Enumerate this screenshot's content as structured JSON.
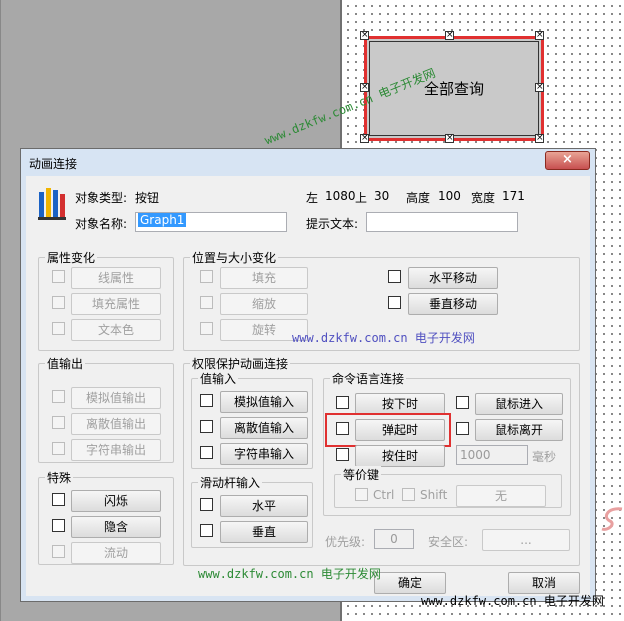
{
  "canvas": {
    "graph_button_label": "全部查询"
  },
  "dialog": {
    "title": "动画连接",
    "close_label": "×",
    "object_type_label": "对象类型:",
    "object_type_value": "按钮",
    "left_label": "左",
    "left_value": "1080",
    "top_label": "上",
    "top_value": "30",
    "height_label": "高度",
    "height_value": "100",
    "width_label": "宽度",
    "width_value": "171",
    "object_name_label": "对象名称:",
    "object_name_value": "Graph1",
    "tooltip_label": "提示文本:",
    "tooltip_value": ""
  },
  "groups": {
    "attr_change": {
      "label": "属性变化",
      "items": [
        "线属性",
        "填充属性",
        "文本色"
      ]
    },
    "pos_size": {
      "label": "位置与大小变化",
      "left_items": [
        "填充",
        "缩放",
        "旋转"
      ],
      "right_items": [
        "水平移动",
        "垂直移动"
      ]
    },
    "value_output": {
      "label": "值输出",
      "items": [
        "模拟值输出",
        "离散值输出",
        "字符串输出"
      ]
    },
    "perm": {
      "label": "权限保护动画连接"
    },
    "value_input": {
      "label": "值输入",
      "items": [
        "模拟值输入",
        "离散值输入",
        "字符串输入"
      ]
    },
    "cmd": {
      "label": "命令语言连接",
      "left_items": [
        "按下时",
        "弹起时",
        "按住时"
      ],
      "right_items": [
        "鼠标进入",
        "鼠标离开"
      ],
      "hold_value": "1000",
      "hold_unit": "毫秒"
    },
    "hotkey": {
      "label": "等价键",
      "ctrl": "Ctrl",
      "shift": "Shift",
      "key_value": "无"
    },
    "priority_label": "优先级:",
    "priority_value": "0",
    "security_label": "安全区:",
    "security_value": "...",
    "special": {
      "label": "特殊",
      "items": [
        "闪烁",
        "隐含",
        "流动"
      ]
    },
    "slider": {
      "label": "滑动杆输入",
      "items": [
        "水平",
        "垂直"
      ]
    }
  },
  "footer": {
    "ok": "确定",
    "cancel": "取消"
  },
  "watermarks": {
    "w1": "www.dzkfw.com.cn 电子开发网",
    "w2": "www.dzkfw.com.cn 电子开发网",
    "w3": "www.dzkfw.com.cn 电子开发网",
    "w4": "www.dzkfw.com.cn 电子开发网"
  },
  "colors": {
    "highlight": "#e03030",
    "selection": "#3399ff",
    "watermark": "#2c8a35"
  }
}
